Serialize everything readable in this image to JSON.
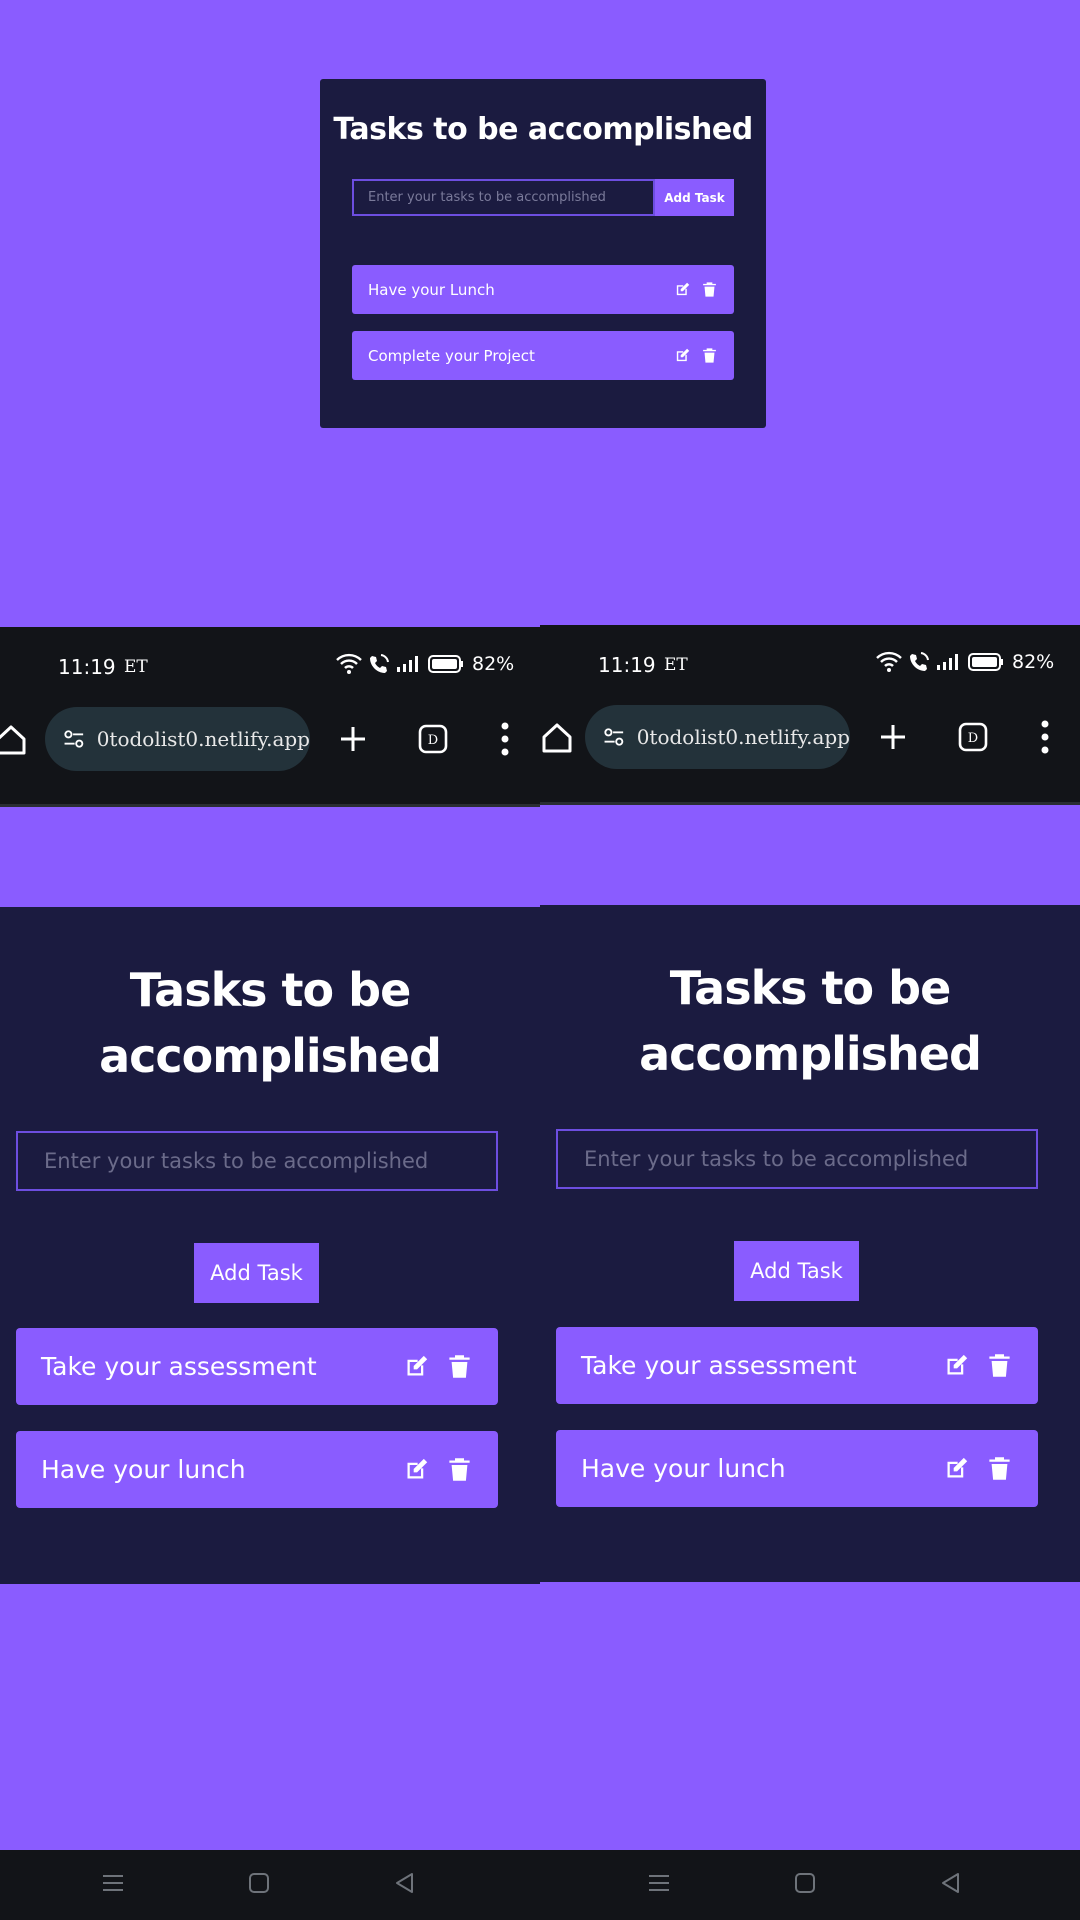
{
  "desktop": {
    "title": "Tasks to be accomplished",
    "input_placeholder": "Enter your tasks to be accomplished",
    "add_button": "Add Task",
    "tasks": [
      {
        "label": "Have your Lunch"
      },
      {
        "label": "Complete your Project"
      }
    ]
  },
  "phone_left": {
    "status": {
      "time": "11:19",
      "carrier": "ET",
      "battery": "82%"
    },
    "browser": {
      "url": "0todolist0.netlify.app",
      "tab_icon_label": "D"
    },
    "app": {
      "title": "Tasks to be accomplished",
      "input_placeholder": "Enter your tasks to be accomplished",
      "add_button": "Add Task",
      "tasks": [
        {
          "label": "Take your assessment"
        },
        {
          "label": "Have your lunch"
        }
      ]
    }
  },
  "phone_right": {
    "status": {
      "time": "11:19",
      "carrier": "ET",
      "battery": "82%"
    },
    "browser": {
      "url": "0todolist0.netlify.app",
      "tab_icon_label": "D"
    },
    "app": {
      "title": "Tasks to be accomplished",
      "input_placeholder": "Enter your tasks to be accomplished",
      "add_button": "Add Task",
      "tasks": [
        {
          "label": "Take your assessment"
        },
        {
          "label": "Have your lunch"
        }
      ]
    }
  },
  "icons": {
    "edit": "edit-icon",
    "delete": "trash-icon",
    "wifi": "wifi-icon",
    "call": "wifi-call-icon",
    "signal": "signal-icon",
    "battery": "battery-icon",
    "home": "home-icon",
    "site_settings": "tune-icon",
    "new_tab": "plus-icon",
    "tabs": "tabs-icon",
    "menu": "more-vert-icon",
    "nav_menu": "nav-menu-icon",
    "nav_home": "nav-home-icon",
    "nav_back": "nav-back-icon"
  },
  "colors": {
    "background": "#8a5cff",
    "card": "#1b1b40",
    "accent": "#8a5cff",
    "input_border": "#6d4ee0",
    "system_bar": "#121418"
  }
}
